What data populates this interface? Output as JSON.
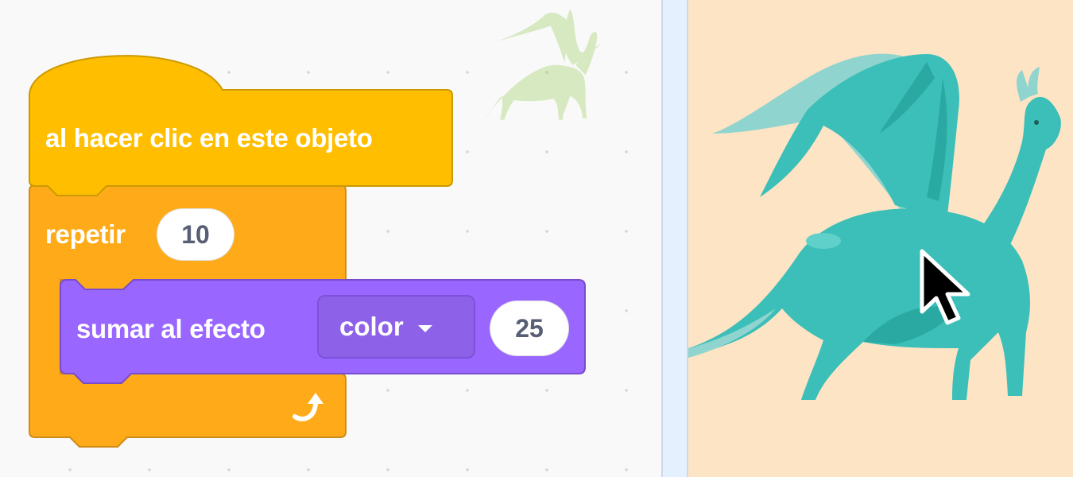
{
  "blocks": {
    "event_hat": {
      "label": "al hacer clic en este objeto",
      "color": "#FFBF00"
    },
    "repeat": {
      "label": "repetir",
      "times": "10",
      "color": "#FFAB19"
    },
    "change_effect": {
      "label": "sumar al efecto",
      "effect": "color",
      "amount": "25",
      "color": "#9966FF"
    }
  },
  "icons": {
    "loop_arrow": "loop-arrow-icon",
    "dropdown_caret": "caret-down-icon",
    "cursor": "mouse-pointer-icon",
    "sprite": "dragon-sprite"
  },
  "colors": {
    "workspace_bg": "#F9F9F9",
    "stage_bg": "#FDE4C4",
    "sprite_teal": "#3BBFB8"
  }
}
